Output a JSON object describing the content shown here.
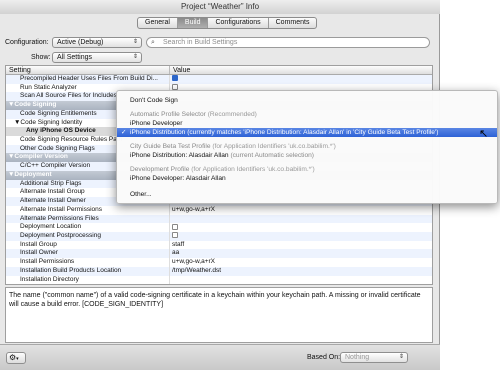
{
  "window": {
    "title": "Project “Weather” Info"
  },
  "tabs": [
    {
      "label": "General"
    },
    {
      "label": "Build"
    },
    {
      "label": "Configurations"
    },
    {
      "label": "Comments"
    }
  ],
  "controls": {
    "configuration_label": "Configuration:",
    "configuration_value": "Active (Debug)",
    "show_label": "Show:",
    "show_value": "All Settings",
    "search_placeholder": "Search in Build Settings"
  },
  "table": {
    "headers": {
      "setting": "Setting",
      "value": "Value"
    },
    "rows": [
      {
        "setting": "Precompiled Header Uses Files From Build Di...",
        "value": "",
        "checkbox": "on",
        "indent": 2
      },
      {
        "setting": "Run Static Analyzer",
        "value": "",
        "checkbox": "off",
        "indent": 2
      },
      {
        "setting": "Scan All Source Files for Includes",
        "value": "",
        "checkbox": "",
        "indent": 2
      },
      {
        "setting": "▼Code Signing",
        "value": "",
        "group": true
      },
      {
        "setting": "Code Signing Entitlements",
        "value": "",
        "indent": 2
      },
      {
        "setting": "▼Code Signing Identity",
        "value": "",
        "indent": 1
      },
      {
        "setting": "Any iPhone OS Device",
        "value": "",
        "indent": 3,
        "selected": true
      },
      {
        "setting": "Code Signing Resource Rules Path",
        "value": "",
        "indent": 2
      },
      {
        "setting": "Other Code Signing Flags",
        "value": "",
        "indent": 2
      },
      {
        "setting": "▼Compiler Version",
        "value": "",
        "group": true
      },
      {
        "setting": "C/C++ Compiler Version",
        "value": "",
        "indent": 2
      },
      {
        "setting": "▼Deployment",
        "value": "",
        "group": true
      },
      {
        "setting": "Additional Strip Flags",
        "value": "",
        "indent": 2
      },
      {
        "setting": "Alternate Install Group",
        "value": "",
        "indent": 2
      },
      {
        "setting": "Alternate Install Owner",
        "value": "",
        "indent": 2
      },
      {
        "setting": "Alternate Install Permissions",
        "value": "u+w,go-w,a+rX",
        "indent": 2
      },
      {
        "setting": "Alternate Permissions Files",
        "value": "",
        "indent": 2
      },
      {
        "setting": "Deployment Location",
        "value": "",
        "checkbox": "off",
        "indent": 2
      },
      {
        "setting": "Deployment Postprocessing",
        "value": "",
        "checkbox": "off",
        "indent": 2
      },
      {
        "setting": "Install Group",
        "value": "staff",
        "indent": 2
      },
      {
        "setting": "Install Owner",
        "value": "aa",
        "indent": 2
      },
      {
        "setting": "Install Permissions",
        "value": "u+w,go-w,a+rX",
        "indent": 2
      },
      {
        "setting": "Installation Build Products Location",
        "value": "/tmp/Weather.dst",
        "indent": 2
      },
      {
        "setting": "Installation Directory",
        "value": "",
        "indent": 2
      },
      {
        "setting": "...",
        "value": "",
        "indent": 2
      }
    ]
  },
  "description": "The name (\"common name\") of a valid code-signing certificate in a keychain within your keychain path.   A missing or invalid certificate will cause a build error. [CODE_SIGN_IDENTITY]",
  "bottom": {
    "gear_icon": "gear-icon",
    "based_on_label": "Based On:",
    "based_on_value": "Nothing"
  },
  "menu": {
    "items": [
      {
        "type": "item",
        "text": "Don't Code Sign",
        "dim": ""
      },
      {
        "type": "header",
        "text": "Automatic Profile Selector",
        "dim": "(Recommended)"
      },
      {
        "type": "item",
        "text": "iPhone Developer",
        "dim": ""
      },
      {
        "type": "item",
        "text": "iPhone Distribution",
        "dim": "(currently matches 'iPhone Distribution: Alasdair Allan' in 'City Guide Beta Test Profile')",
        "checked": true,
        "highlighted": true
      },
      {
        "type": "header",
        "text": "City Guide Beta Test Profile",
        "dim": "(for Application Identifiers 'uk.co.babilim.*')"
      },
      {
        "type": "item",
        "text": "iPhone Distribution: Alasdair Allan",
        "dim": "(current Automatic selection)"
      },
      {
        "type": "header",
        "text": "Development Profile",
        "dim": "(for Application Identifiers 'uk.co.babilim.*')"
      },
      {
        "type": "item",
        "text": "iPhone Developer: Alasdair Allan",
        "dim": ""
      },
      {
        "type": "item",
        "text": "Other...",
        "dim": ""
      }
    ],
    "check_mark": "✓"
  },
  "colors": {
    "selection": "#2e62d6",
    "group_header": "#aab3c0"
  }
}
